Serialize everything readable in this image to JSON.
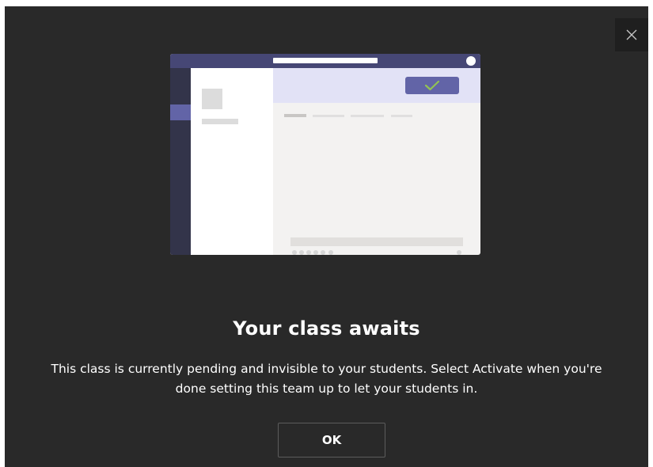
{
  "dialog": {
    "title": "Your class awaits",
    "body": "This class is currently pending and invisible to your students. Select Activate when you're done setting this team up to let your students in.",
    "ok_label": "OK",
    "close_icon": "close-icon"
  },
  "illustration": {
    "check_icon": "checkmark-icon",
    "colors": {
      "titlebar": "#464775",
      "rail": "#33344a",
      "accent": "#6264a7",
      "check": "#92c353"
    }
  }
}
